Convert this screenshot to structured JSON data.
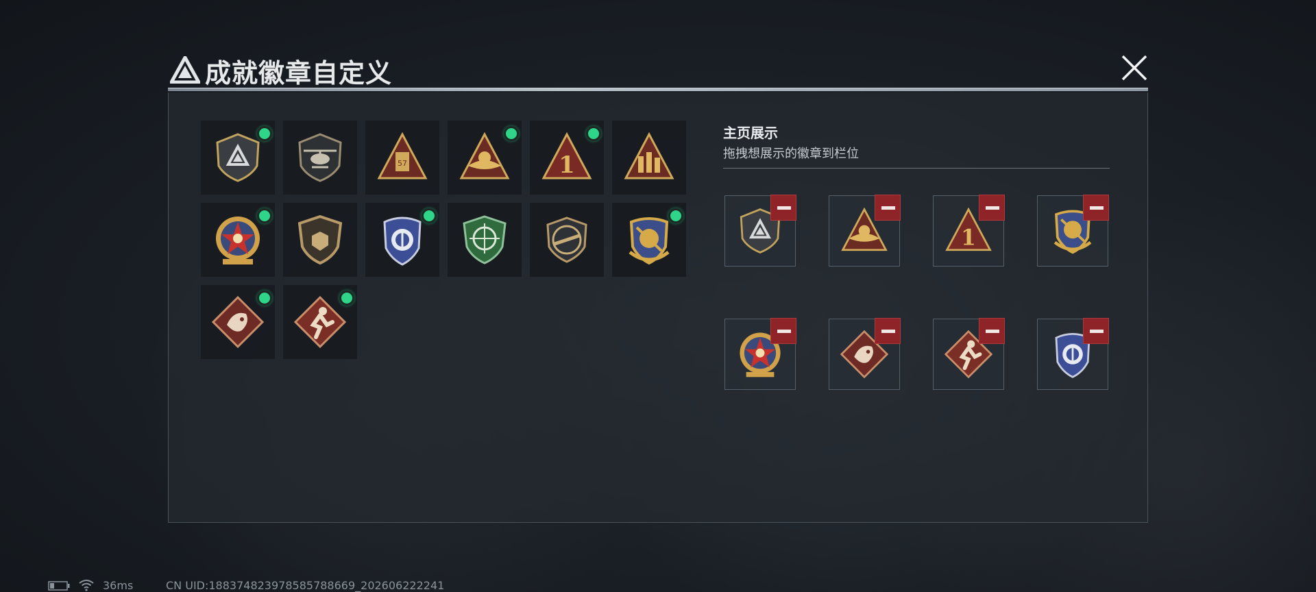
{
  "dialog": {
    "title": "成就徽章自定义",
    "close_icon": "close-icon"
  },
  "badges": [
    {
      "name": "shield-logo-badge",
      "new": true
    },
    {
      "name": "helicopter-badge",
      "new": false
    },
    {
      "name": "tower-triangle-badge",
      "new": false
    },
    {
      "name": "eagle-triangle-badge",
      "new": true
    },
    {
      "name": "number-one-triangle-badge",
      "new": true
    },
    {
      "name": "soldiers-triangle-badge",
      "new": false
    },
    {
      "name": "star-medal-badge",
      "new": true
    },
    {
      "name": "bronze-shield-badge",
      "new": false
    },
    {
      "name": "blue-police-badge",
      "new": true
    },
    {
      "name": "green-crosshair-badge",
      "new": false
    },
    {
      "name": "rifle-shield-badge",
      "new": false
    },
    {
      "name": "gold-crest-badge",
      "new": true
    },
    {
      "name": "dragon-diamond-badge",
      "new": true
    },
    {
      "name": "runner-diamond-badge",
      "new": true
    }
  ],
  "showcase": {
    "title": "主页展示",
    "subtitle": "拖拽想展示的徽章到栏位",
    "slots": [
      "shield-logo-badge",
      "eagle-triangle-badge",
      "number-one-triangle-badge",
      "gold-crest-badge",
      "star-medal-badge",
      "dragon-diamond-badge",
      "runner-diamond-badge",
      "blue-police-badge"
    ]
  },
  "status": {
    "ping": "36ms",
    "uid": "CN UID:18837482397858578866​9_202606222241"
  },
  "colors": {
    "new_indicator": "#2fd68a",
    "remove_button": "#8e2427",
    "panel_bg": "#242930"
  }
}
